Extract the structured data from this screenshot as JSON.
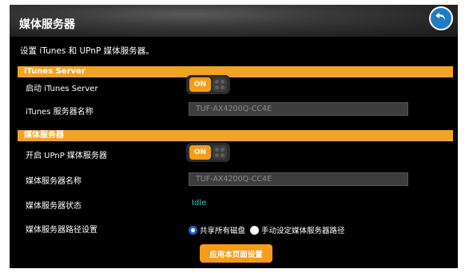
{
  "page": {
    "title": "媒体服务器",
    "description": "设置 iTunes 和 UPnP 媒体服务器。"
  },
  "itunes_section": {
    "heading": "iTunes Server",
    "enable_label": "启动 iTunes Server",
    "enable_toggle": "ON",
    "server_name_label": "iTunes 服务器名称",
    "server_name_value": "TUF-AX4200Q-CC4E"
  },
  "media_section": {
    "heading": "媒体服务器",
    "upnp_label": "开启 UPnP 媒体服务器",
    "upnp_toggle": "ON",
    "server_name_label": "媒体服务器名称",
    "server_name_value": "TUF-AX4200Q-CC4E",
    "status_label": "媒体服务器状态",
    "status_value": "Idle",
    "path_label": "媒体服务器路径设置",
    "path_options": [
      "共享所有磁盘",
      "手动设定媒体服务器路径"
    ],
    "path_selected": "共享所有磁盘"
  },
  "actions": {
    "apply_label": "应用本页面设置"
  },
  "colors": {
    "accent": "#f59c1a",
    "section_bar": "#f0a324",
    "status": "#35c9d8",
    "back_button": "#1f7cc4"
  },
  "icons": {
    "back": "back-arrow-icon"
  }
}
